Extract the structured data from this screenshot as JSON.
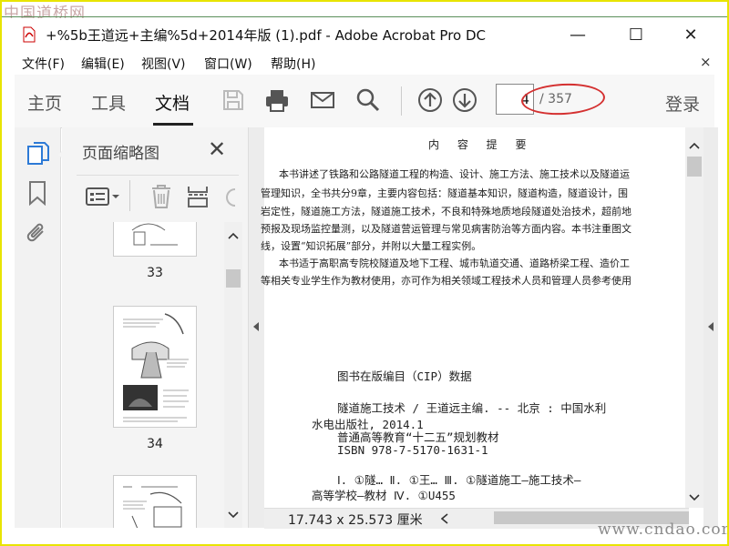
{
  "watermark": {
    "top": "中国道桥网",
    "bottom": "www.cndao.com"
  },
  "window": {
    "title": "+%5b王道远+主编%5d+2014年版 (1).pdf - Adobe Acrobat Pro DC",
    "minimize": "—",
    "maximize": "☐",
    "close": "✕"
  },
  "menu": {
    "items": [
      "文件(F)",
      "编辑(E)",
      "视图(V)",
      "窗口(W)",
      "帮助(H)"
    ],
    "close_doc": "×"
  },
  "toolbar": {
    "tabs": [
      "主页",
      "工具",
      "文档"
    ],
    "active_tab": "文档",
    "page_current": "4",
    "page_total": "/ 357",
    "login": "登录"
  },
  "panel": {
    "title": "页面缩略图",
    "close": "✕",
    "thumbnails": [
      {
        "page": "33"
      },
      {
        "page": "34"
      }
    ]
  },
  "document": {
    "title": "内 容 提 要",
    "paragraphs": [
      "本书讲述了铁路和公路隧道工程的构造、设计、施工方法、施工技术以及隧道运",
      "管理知识，全书共分9章，主要内容包括：隧道基本知识，隧道构造，隧道设计，围",
      "岩定性，隧道施工方法，隧道施工技术，不良和特殊地质地段隧道处治技术，超前地",
      "预报及现场监控量测，以及隧道营运管理与常见病害防治等方面内容。本书注重图文",
      "线，设置“知识拓展”部分，并附以大量工程实例。",
      "本书适于高职高专院校隧道及地下工程、城市轨道交通、道路桥梁工程、造价工",
      "等相关专业学生作为教材使用，亦可作为相关领域工程技术人员和管理人员参考使用"
    ],
    "cip_lines": [
      "图书在版编目（CIP）数据",
      "隧道施工技术 / 王道远主编. -- 北京 : 中国水利",
      "水电出版社, 2014.1",
      "普通高等教育“十二五”规划教材",
      "ISBN 978-7-5170-1631-1",
      "Ⅰ. ①隧… Ⅱ. ①王… Ⅲ. ①隧道施工—施工技术—",
      "高等学校—教材 Ⅳ. ①U455"
    ]
  },
  "status": {
    "dimensions": "17.743 x 25.573 厘米"
  }
}
